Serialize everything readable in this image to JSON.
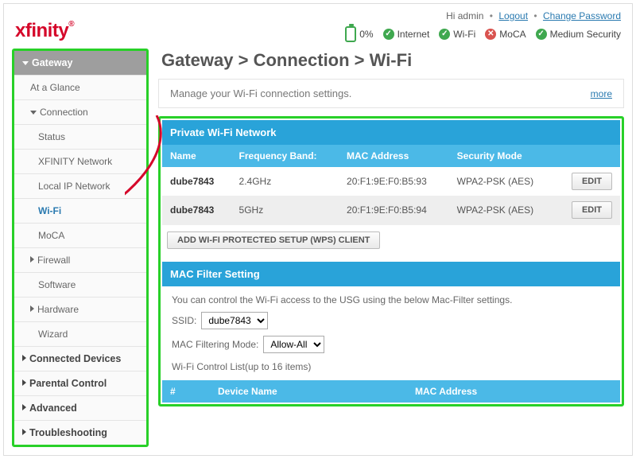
{
  "header": {
    "logo": "xfinity",
    "greeting": "Hi admin",
    "logout": "Logout",
    "change_password": "Change Password",
    "battery_pct": "0%",
    "status": [
      {
        "label": "Internet",
        "ok": true
      },
      {
        "label": "Wi-Fi",
        "ok": true
      },
      {
        "label": "MoCA",
        "ok": false
      },
      {
        "label": "Medium Security",
        "ok": true
      }
    ]
  },
  "sidebar": {
    "gateway": "Gateway",
    "at_a_glance": "At a Glance",
    "connection": "Connection",
    "status": "Status",
    "xfinity_network": "XFINITY Network",
    "local_ip": "Local IP Network",
    "wifi": "Wi-Fi",
    "moca": "MoCA",
    "firewall": "Firewall",
    "software": "Software",
    "hardware": "Hardware",
    "wizard": "Wizard",
    "connected_devices": "Connected Devices",
    "parental_control": "Parental Control",
    "advanced": "Advanced",
    "troubleshooting": "Troubleshooting"
  },
  "breadcrumb": "Gateway > Connection > Wi-Fi",
  "panel": {
    "text": "Manage your Wi-Fi connection settings.",
    "more": "more"
  },
  "private_wifi": {
    "title": "Private Wi-Fi Network",
    "cols": {
      "name": "Name",
      "band": "Frequency Band:",
      "mac": "MAC Address",
      "sec": "Security Mode"
    },
    "rows": [
      {
        "name": "dube7843",
        "band": "2.4GHz",
        "mac": "20:F1:9E:F0:B5:93",
        "sec": "WPA2-PSK (AES)"
      },
      {
        "name": "dube7843",
        "band": "5GHz",
        "mac": "20:F1:9E:F0:B5:94",
        "sec": "WPA2-PSK (AES)"
      }
    ],
    "edit": "EDIT",
    "wps_btn": "ADD WI-FI PROTECTED SETUP (WPS) CLIENT"
  },
  "mac_filter": {
    "title": "MAC Filter Setting",
    "intro": "You can control the Wi-Fi access to the USG using the below Mac-Filter settings.",
    "ssid_label": "SSID:",
    "ssid_value": "dube7843",
    "mode_label": "MAC Filtering Mode:",
    "mode_value": "Allow-All",
    "list_caption": "Wi-Fi Control List(up to 16 items)",
    "list_cols": {
      "idx": "#",
      "device": "Device Name",
      "mac": "MAC Address"
    }
  }
}
